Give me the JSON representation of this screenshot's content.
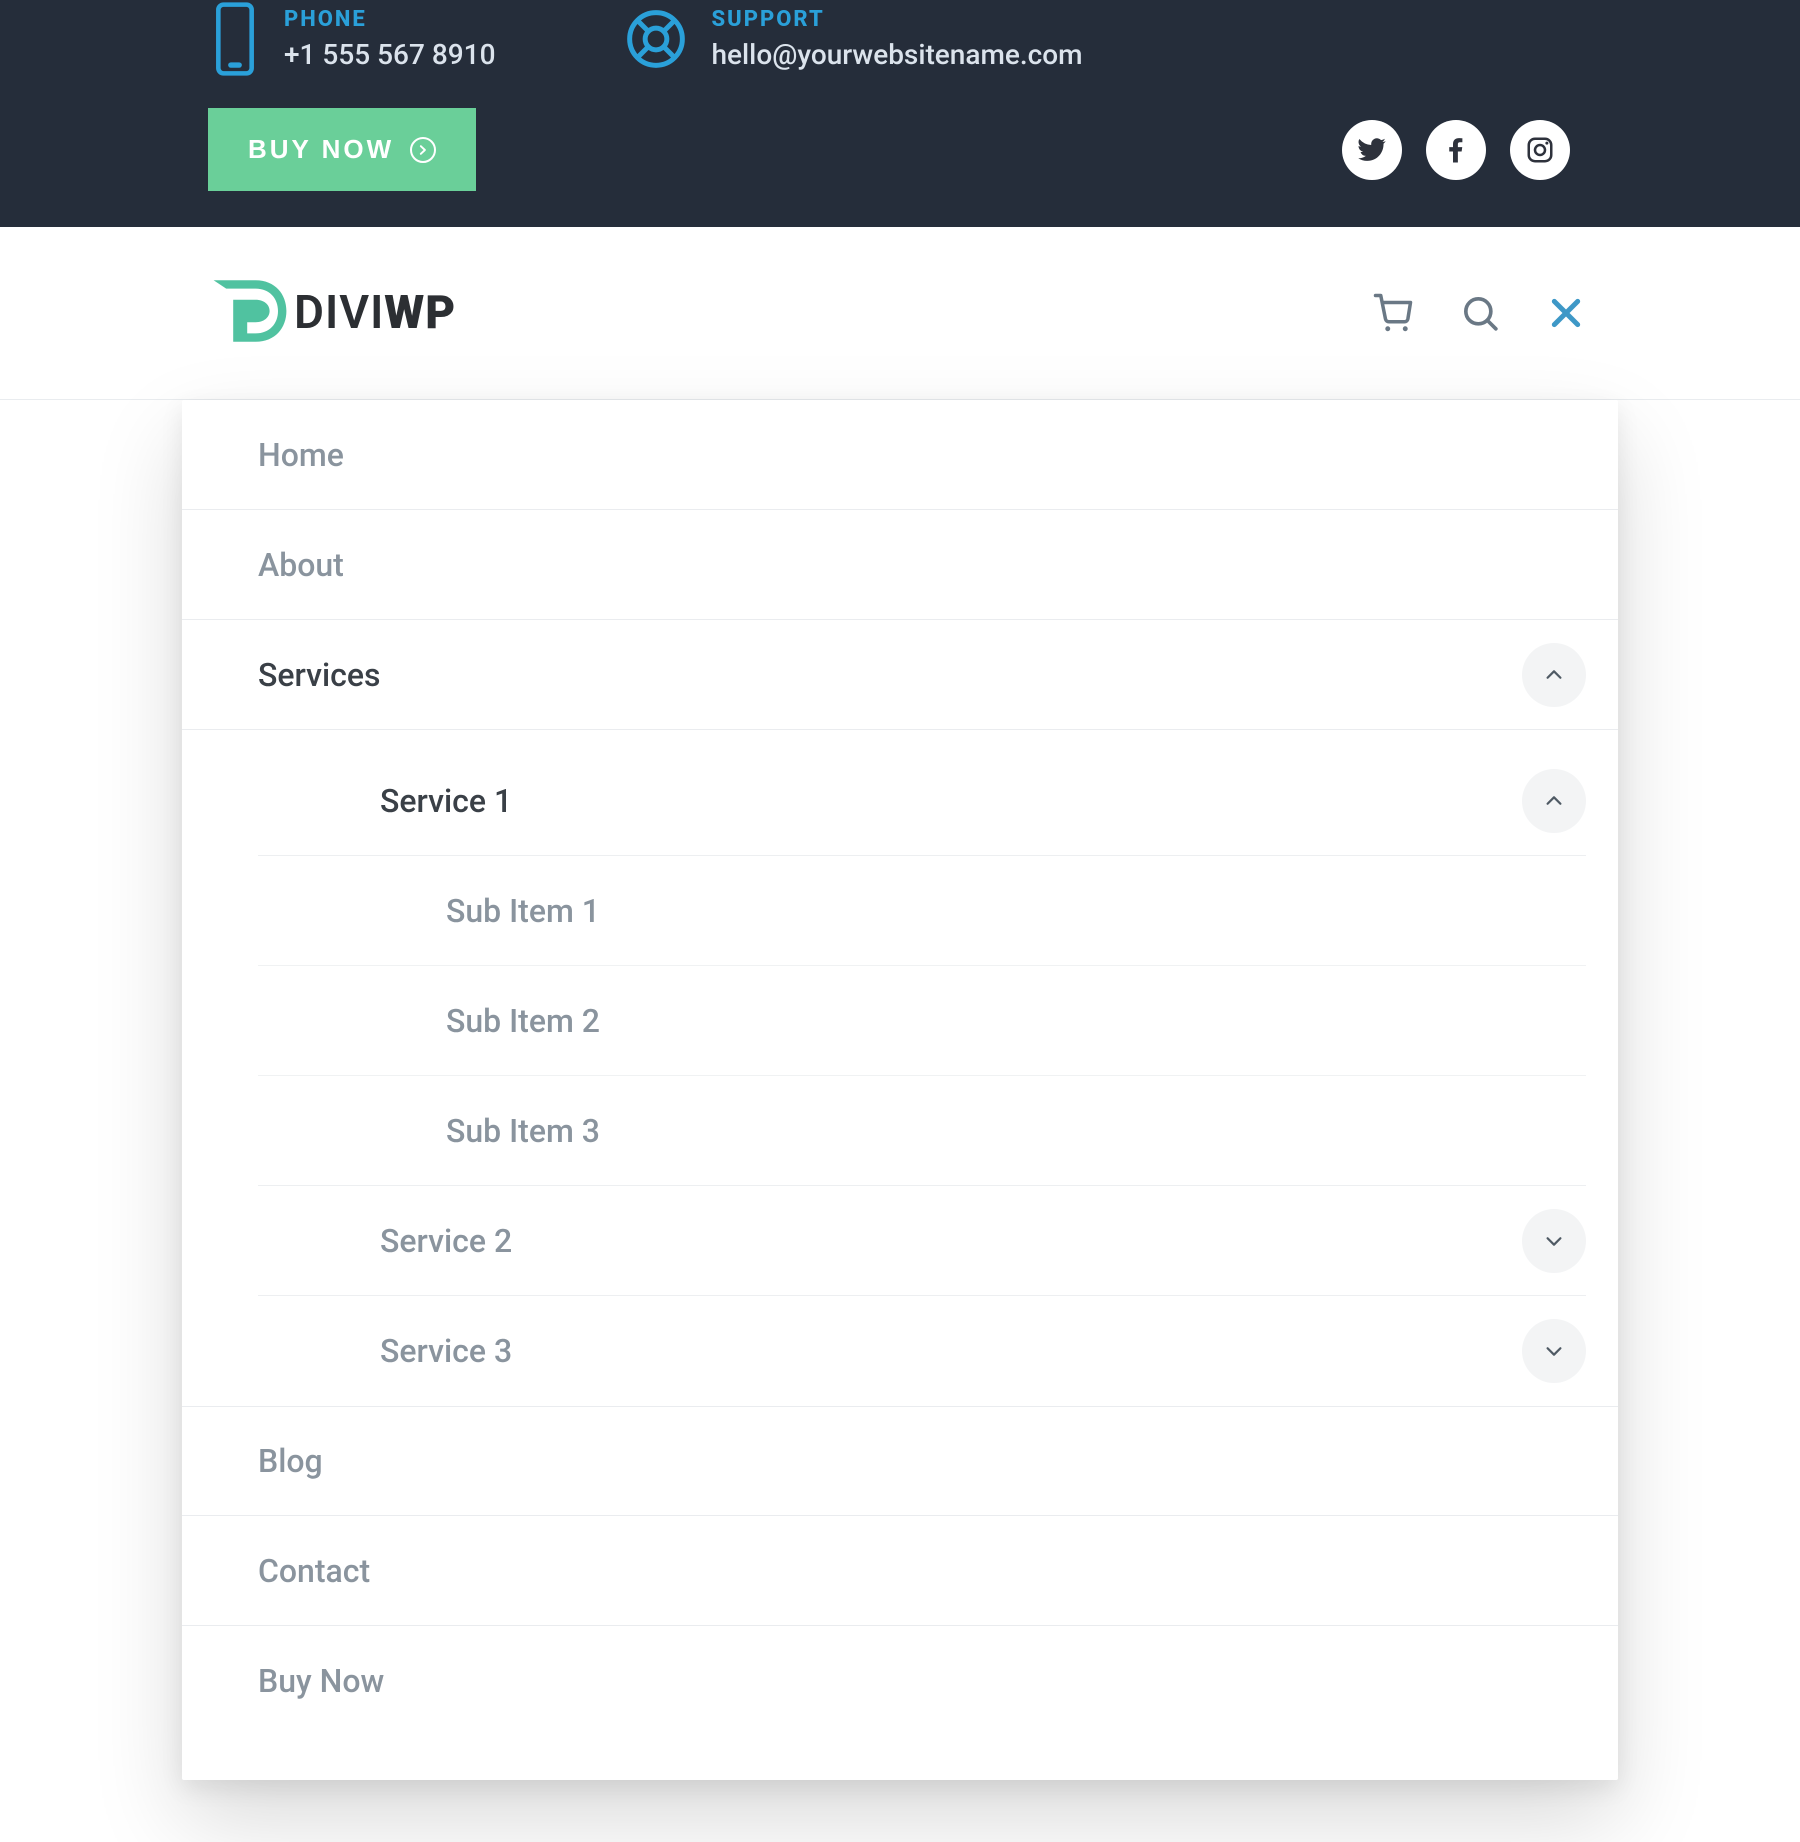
{
  "topbar": {
    "phone": {
      "label": "PHONE",
      "value": "+1 555 567 8910"
    },
    "support": {
      "label": "SUPPORT",
      "value": "hello@yourwebsitename.com"
    },
    "buy_label": "BUY NOW",
    "social_names": {
      "twitter": "twitter-icon",
      "facebook": "facebook-icon",
      "instagram": "instagram-icon"
    }
  },
  "logo": {
    "part1": "DIVI",
    "part2": "WP"
  },
  "menu": {
    "home": "Home",
    "about": "About",
    "services": {
      "label": "Services",
      "items": {
        "s1": {
          "label": "Service 1",
          "sub": {
            "a": "Sub Item 1",
            "b": "Sub Item 2",
            "c": "Sub Item 3"
          }
        },
        "s2": {
          "label": "Service 2"
        },
        "s3": {
          "label": "Service 3"
        }
      }
    },
    "blog": "Blog",
    "contact": "Contact",
    "buynow": "Buy Now"
  },
  "colors": {
    "brand_teal": "#50c2a0",
    "brand_green_btn": "#6acf99",
    "link_blue": "#2aa0d9",
    "dark_bg": "#252d3a",
    "text_muted": "#8a949e",
    "text_active": "#3a4047"
  }
}
